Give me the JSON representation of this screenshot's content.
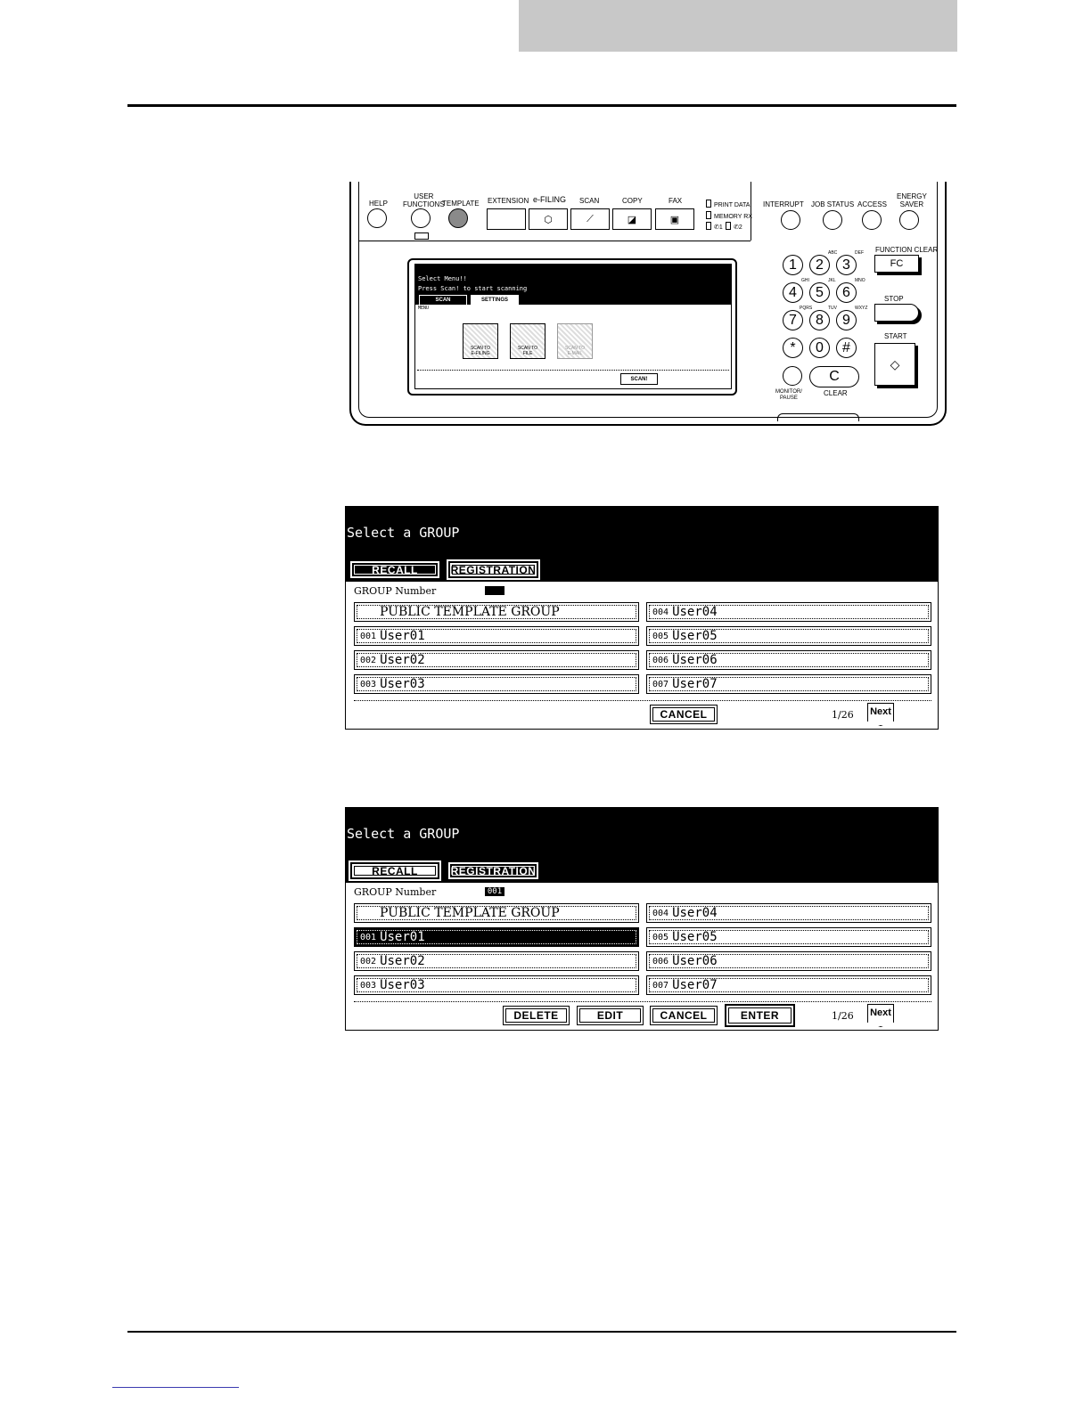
{
  "panel": {
    "buttons": {
      "help": "HELP",
      "user_functions": "USER\nFUNCTIONS",
      "template": "TEMPLATE",
      "extension": "EXTENSION",
      "e_filing": "e-FILING",
      "scan": "SCAN",
      "copy": "COPY",
      "fax": "FAX",
      "interrupt": "INTERRUPT",
      "job_status": "JOB STATUS",
      "access": "ACCESS",
      "energy_saver": "ENERGY\nSAVER",
      "function_clear": "FUNCTION CLEAR",
      "fc": "FC",
      "stop": "STOP",
      "start": "START",
      "monitor_pause": "MONITOR/\nPAUSE",
      "clear": "CLEAR",
      "clear_key": "C"
    },
    "leds": {
      "print_data": "PRINT DATA",
      "memory_rx": "MEMORY RX",
      "line1": "1",
      "line2": "2"
    },
    "keypad": {
      "keys": [
        "1",
        "2",
        "3",
        "4",
        "5",
        "6",
        "7",
        "8",
        "9",
        "*",
        "0",
        "#"
      ],
      "subs": [
        "ABC",
        "DEF",
        "GHI",
        "JKL",
        "MNO",
        "PQRS",
        "TUV",
        "WXYZ"
      ]
    },
    "lcd": {
      "line1": "Select Menu!!",
      "line2": "Press Scan! to start scanning",
      "tab_scan": "SCAN",
      "tab_settings": "SETTINGS",
      "sub": "MENU",
      "icon1": "SCAN TO\nE-FILING",
      "icon2": "SCAN TO\nFILE",
      "icon3": "SCAN TO\nE-MAIL",
      "scan_btn": "SCAN!"
    }
  },
  "screen1": {
    "title": "Select a GROUP",
    "tab_recall": "RECALL",
    "tab_registration": "REGISTRATION",
    "group_number_label": "GROUP Number",
    "group_number_value": "",
    "groups_left": [
      {
        "num": "",
        "name": "PUBLIC TEMPLATE GROUP"
      },
      {
        "num": "001",
        "name": "User01"
      },
      {
        "num": "002",
        "name": "User02"
      },
      {
        "num": "003",
        "name": "User03"
      }
    ],
    "groups_right": [
      {
        "num": "004",
        "name": "User04"
      },
      {
        "num": "005",
        "name": "User05"
      },
      {
        "num": "006",
        "name": "User06"
      },
      {
        "num": "007",
        "name": "User07"
      }
    ],
    "cancel": "CANCEL",
    "page": "1/26",
    "next": "Next"
  },
  "screen2": {
    "title": "Select a GROUP",
    "tab_recall": "RECALL",
    "tab_registration": "REGISTRATION",
    "group_number_label": "GROUP Number",
    "group_number_value": "001",
    "groups_left": [
      {
        "num": "",
        "name": "PUBLIC TEMPLATE GROUP"
      },
      {
        "num": "001",
        "name": "User01"
      },
      {
        "num": "002",
        "name": "User02"
      },
      {
        "num": "003",
        "name": "User03"
      }
    ],
    "groups_right": [
      {
        "num": "004",
        "name": "User04"
      },
      {
        "num": "005",
        "name": "User05"
      },
      {
        "num": "006",
        "name": "User06"
      },
      {
        "num": "007",
        "name": "User07"
      }
    ],
    "delete": "DELETE",
    "edit": "EDIT",
    "cancel": "CANCEL",
    "enter": "ENTER",
    "page": "1/26",
    "next": "Next"
  }
}
